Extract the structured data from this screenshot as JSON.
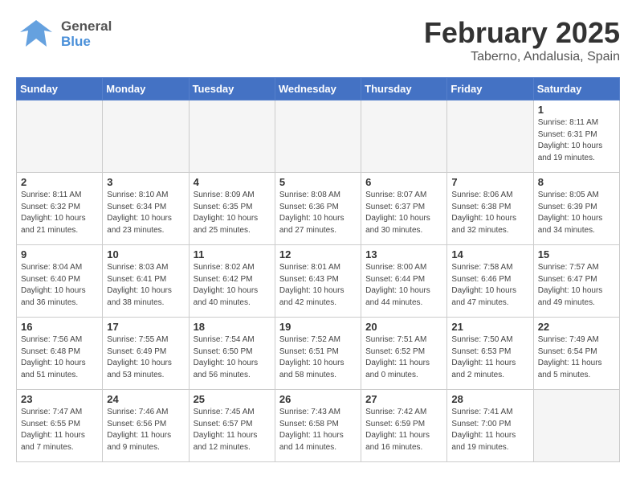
{
  "header": {
    "logo_general": "General",
    "logo_blue": "Blue",
    "title": "February 2025",
    "subtitle": "Taberno, Andalusia, Spain"
  },
  "weekdays": [
    "Sunday",
    "Monday",
    "Tuesday",
    "Wednesday",
    "Thursday",
    "Friday",
    "Saturday"
  ],
  "weeks": [
    [
      {
        "day": "",
        "empty": true
      },
      {
        "day": "",
        "empty": true
      },
      {
        "day": "",
        "empty": true
      },
      {
        "day": "",
        "empty": true
      },
      {
        "day": "",
        "empty": true
      },
      {
        "day": "",
        "empty": true
      },
      {
        "day": "1",
        "info": "Sunrise: 8:11 AM\nSunset: 6:31 PM\nDaylight: 10 hours\nand 19 minutes."
      }
    ],
    [
      {
        "day": "2",
        "info": "Sunrise: 8:11 AM\nSunset: 6:32 PM\nDaylight: 10 hours\nand 21 minutes."
      },
      {
        "day": "3",
        "info": "Sunrise: 8:10 AM\nSunset: 6:34 PM\nDaylight: 10 hours\nand 23 minutes."
      },
      {
        "day": "4",
        "info": "Sunrise: 8:09 AM\nSunset: 6:35 PM\nDaylight: 10 hours\nand 25 minutes."
      },
      {
        "day": "5",
        "info": "Sunrise: 8:08 AM\nSunset: 6:36 PM\nDaylight: 10 hours\nand 27 minutes."
      },
      {
        "day": "6",
        "info": "Sunrise: 8:07 AM\nSunset: 6:37 PM\nDaylight: 10 hours\nand 30 minutes."
      },
      {
        "day": "7",
        "info": "Sunrise: 8:06 AM\nSunset: 6:38 PM\nDaylight: 10 hours\nand 32 minutes."
      },
      {
        "day": "8",
        "info": "Sunrise: 8:05 AM\nSunset: 6:39 PM\nDaylight: 10 hours\nand 34 minutes."
      }
    ],
    [
      {
        "day": "9",
        "info": "Sunrise: 8:04 AM\nSunset: 6:40 PM\nDaylight: 10 hours\nand 36 minutes."
      },
      {
        "day": "10",
        "info": "Sunrise: 8:03 AM\nSunset: 6:41 PM\nDaylight: 10 hours\nand 38 minutes."
      },
      {
        "day": "11",
        "info": "Sunrise: 8:02 AM\nSunset: 6:42 PM\nDaylight: 10 hours\nand 40 minutes."
      },
      {
        "day": "12",
        "info": "Sunrise: 8:01 AM\nSunset: 6:43 PM\nDaylight: 10 hours\nand 42 minutes."
      },
      {
        "day": "13",
        "info": "Sunrise: 8:00 AM\nSunset: 6:44 PM\nDaylight: 10 hours\nand 44 minutes."
      },
      {
        "day": "14",
        "info": "Sunrise: 7:58 AM\nSunset: 6:46 PM\nDaylight: 10 hours\nand 47 minutes."
      },
      {
        "day": "15",
        "info": "Sunrise: 7:57 AM\nSunset: 6:47 PM\nDaylight: 10 hours\nand 49 minutes."
      }
    ],
    [
      {
        "day": "16",
        "info": "Sunrise: 7:56 AM\nSunset: 6:48 PM\nDaylight: 10 hours\nand 51 minutes."
      },
      {
        "day": "17",
        "info": "Sunrise: 7:55 AM\nSunset: 6:49 PM\nDaylight: 10 hours\nand 53 minutes."
      },
      {
        "day": "18",
        "info": "Sunrise: 7:54 AM\nSunset: 6:50 PM\nDaylight: 10 hours\nand 56 minutes."
      },
      {
        "day": "19",
        "info": "Sunrise: 7:52 AM\nSunset: 6:51 PM\nDaylight: 10 hours\nand 58 minutes."
      },
      {
        "day": "20",
        "info": "Sunrise: 7:51 AM\nSunset: 6:52 PM\nDaylight: 11 hours\nand 0 minutes."
      },
      {
        "day": "21",
        "info": "Sunrise: 7:50 AM\nSunset: 6:53 PM\nDaylight: 11 hours\nand 2 minutes."
      },
      {
        "day": "22",
        "info": "Sunrise: 7:49 AM\nSunset: 6:54 PM\nDaylight: 11 hours\nand 5 minutes."
      }
    ],
    [
      {
        "day": "23",
        "info": "Sunrise: 7:47 AM\nSunset: 6:55 PM\nDaylight: 11 hours\nand 7 minutes."
      },
      {
        "day": "24",
        "info": "Sunrise: 7:46 AM\nSunset: 6:56 PM\nDaylight: 11 hours\nand 9 minutes."
      },
      {
        "day": "25",
        "info": "Sunrise: 7:45 AM\nSunset: 6:57 PM\nDaylight: 11 hours\nand 12 minutes."
      },
      {
        "day": "26",
        "info": "Sunrise: 7:43 AM\nSunset: 6:58 PM\nDaylight: 11 hours\nand 14 minutes."
      },
      {
        "day": "27",
        "info": "Sunrise: 7:42 AM\nSunset: 6:59 PM\nDaylight: 11 hours\nand 16 minutes."
      },
      {
        "day": "28",
        "info": "Sunrise: 7:41 AM\nSunset: 7:00 PM\nDaylight: 11 hours\nand 19 minutes."
      },
      {
        "day": "",
        "empty": true
      }
    ]
  ]
}
